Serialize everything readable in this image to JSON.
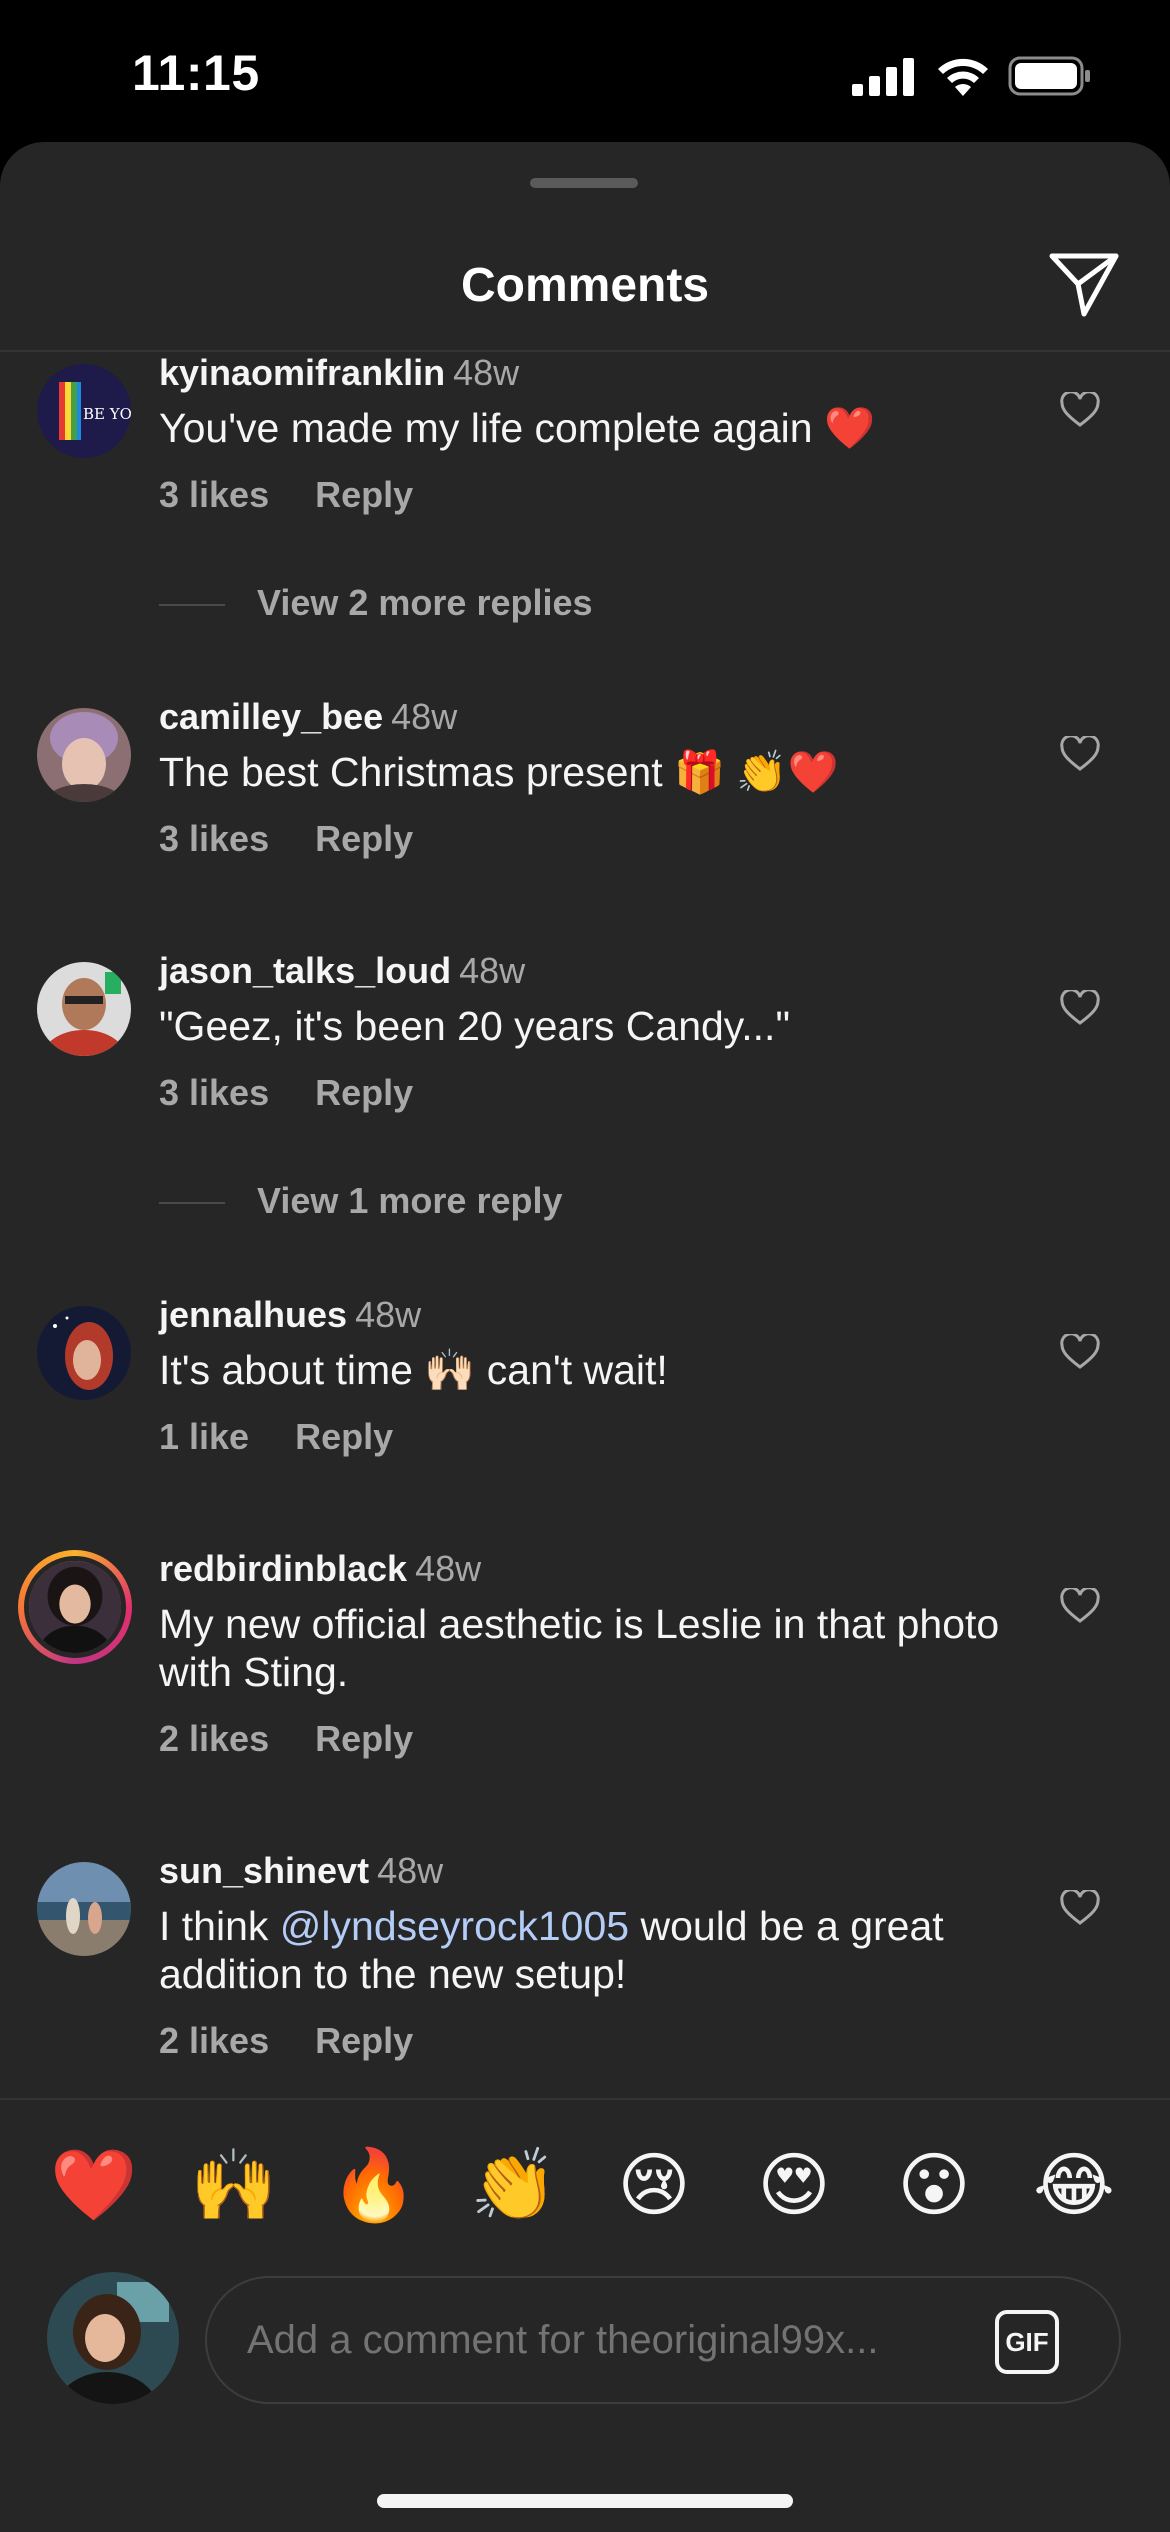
{
  "status_bar": {
    "time": "11:15",
    "icons": [
      "signal-icon",
      "wifi-icon",
      "battery-icon"
    ]
  },
  "header": {
    "title": "Comments",
    "share_icon": "paper-plane-icon"
  },
  "comments": [
    {
      "username": "kyinaomifranklin",
      "time": "48w",
      "text": "You've made my life complete again ❤️",
      "likes": "3 likes",
      "reply": "Reply",
      "view_replies": "View 2 more replies",
      "avatar_text": "BE YOU!"
    },
    {
      "username": "camilley_bee",
      "time": "48w",
      "text": "The best Christmas present 🎁 👏❤️",
      "likes": "3 likes",
      "reply": "Reply"
    },
    {
      "username": "jason_talks_loud",
      "time": "48w",
      "text": "\"Geez, it's been 20 years Candy...\"",
      "likes": "3 likes",
      "reply": "Reply",
      "view_replies": "View 1 more reply"
    },
    {
      "username": "jennalhues",
      "time": "48w",
      "text": "It's about time 🙌🏻 can't wait!",
      "likes": "1 like",
      "reply": "Reply"
    },
    {
      "username": "redbirdinblack",
      "time": "48w",
      "text": "My new official aesthetic is Leslie in that photo with Sting.",
      "likes": "2 likes",
      "reply": "Reply"
    },
    {
      "username": "sun_shinevt",
      "time": "48w",
      "text_before": "I think ",
      "mention": "@lyndseyrock1005",
      "text_after": " would be a great addition to the new setup!",
      "likes": "2 likes",
      "reply": "Reply"
    }
  ],
  "emoji_reactions": [
    "❤️",
    "🙌",
    "🔥",
    "👏",
    "😢",
    "😍",
    "😮",
    "😂"
  ],
  "composer": {
    "placeholder": "Add a comment for theoriginal99x...",
    "gif_label": "GIF"
  },
  "colors": {
    "sheet_background": "#262626",
    "secondary_text": "#a8a8a8",
    "mention": "#b3cdf7"
  }
}
